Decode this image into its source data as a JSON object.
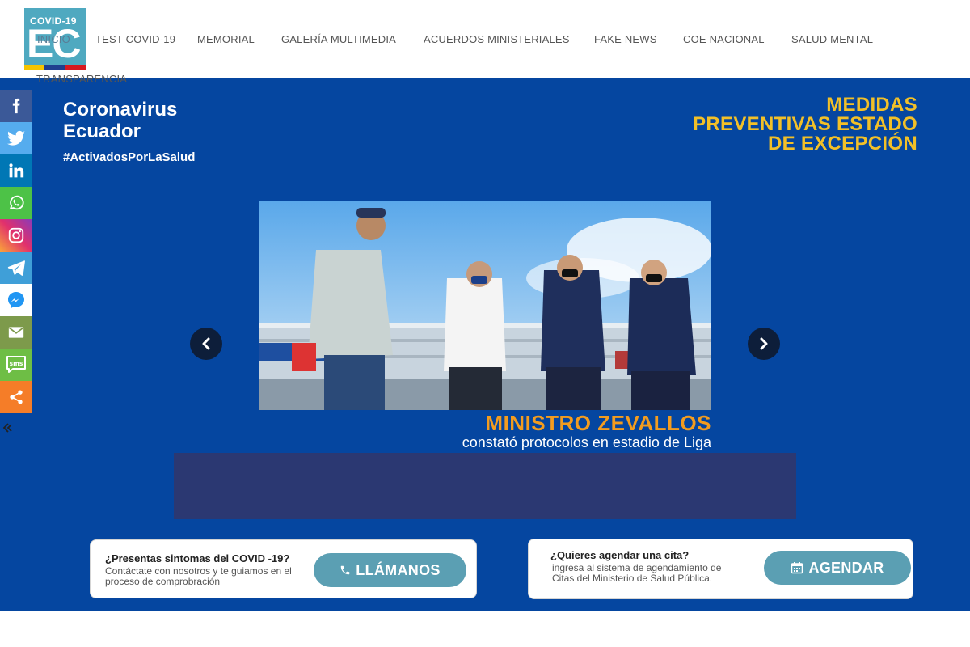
{
  "logo": {
    "top_text": "COVID-19",
    "main_text": "EC",
    "stripe_colors": [
      "#f5c400",
      "#1f3f8f",
      "#d71920"
    ]
  },
  "nav": {
    "items": [
      {
        "label": "INICIO"
      },
      {
        "label": "TEST COVID-19"
      },
      {
        "label": "MEMORIAL"
      },
      {
        "label": "GALERÍA MULTIMEDIA"
      },
      {
        "label": "ACUERDOS MINISTERIALES"
      },
      {
        "label": "FAKE NEWS"
      },
      {
        "label": "COE NACIONAL"
      },
      {
        "label": "SALUD MENTAL"
      },
      {
        "label": "TRANSPARENCIA"
      }
    ]
  },
  "hero": {
    "brand_line1": "Coronavirus",
    "brand_line2": "Ecuador",
    "hashtag": "#ActivadosPorLaSalud",
    "headline_lines": [
      "MEDIDAS",
      "PREVENTIVAS ESTADO",
      "DE EXCEPCIÓN"
    ],
    "caption_title": "MINISTRO ZEVALLOS",
    "caption_subtitle": "constató protocolos en estadio de Liga",
    "colors": {
      "background": "#0546a0",
      "headline": "#f2c028",
      "caption": "#f39c1f"
    }
  },
  "cards": {
    "symptoms": {
      "question": "¿Presentas sintomas del COVID -19?",
      "description": "Contáctate con nosotros y te guiamos en el proceso de comprobración",
      "button_label": "LLÁMANOS"
    },
    "appointment": {
      "question": "¿Quieres agendar una cita?",
      "description": "ingresa al sistema de agendamiento de Citas del Ministerio de Salud Pública.",
      "button_label": "AGENDAR"
    }
  },
  "social": [
    {
      "name": "facebook-icon",
      "color": "#3b5998"
    },
    {
      "name": "twitter-icon",
      "color": "#55acee"
    },
    {
      "name": "linkedin-icon",
      "color": "#0077b5"
    },
    {
      "name": "whatsapp-icon",
      "color": "#4dc247"
    },
    {
      "name": "instagram-icon",
      "color": "#c13584"
    },
    {
      "name": "telegram-icon",
      "color": "#3f9fd8"
    },
    {
      "name": "messenger-icon",
      "color": "#2196f3"
    },
    {
      "name": "email-icon",
      "color": "#7d9a4b"
    },
    {
      "name": "sms-icon",
      "color": "#6ebe45"
    },
    {
      "name": "share-icon",
      "color": "#f57d28"
    }
  ]
}
